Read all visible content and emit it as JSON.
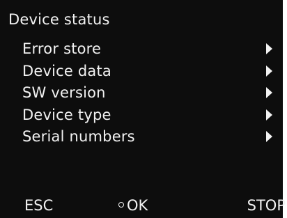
{
  "header": {
    "title": "Device status"
  },
  "menu": {
    "items": [
      {
        "label": "Error store",
        "icon": "chevron-right-icon"
      },
      {
        "label": "Device data",
        "icon": "chevron-right-icon"
      },
      {
        "label": "SW version",
        "icon": "chevron-right-icon"
      },
      {
        "label": "Device type",
        "icon": "chevron-right-icon"
      },
      {
        "label": "Serial numbers",
        "icon": "chevron-right-icon"
      }
    ]
  },
  "softkeys": {
    "esc_label": "ESC",
    "ok_label": "OK",
    "stop_label": "STOP"
  },
  "colors": {
    "background": "#0d0d0d",
    "foreground": "#f2f2f2"
  }
}
